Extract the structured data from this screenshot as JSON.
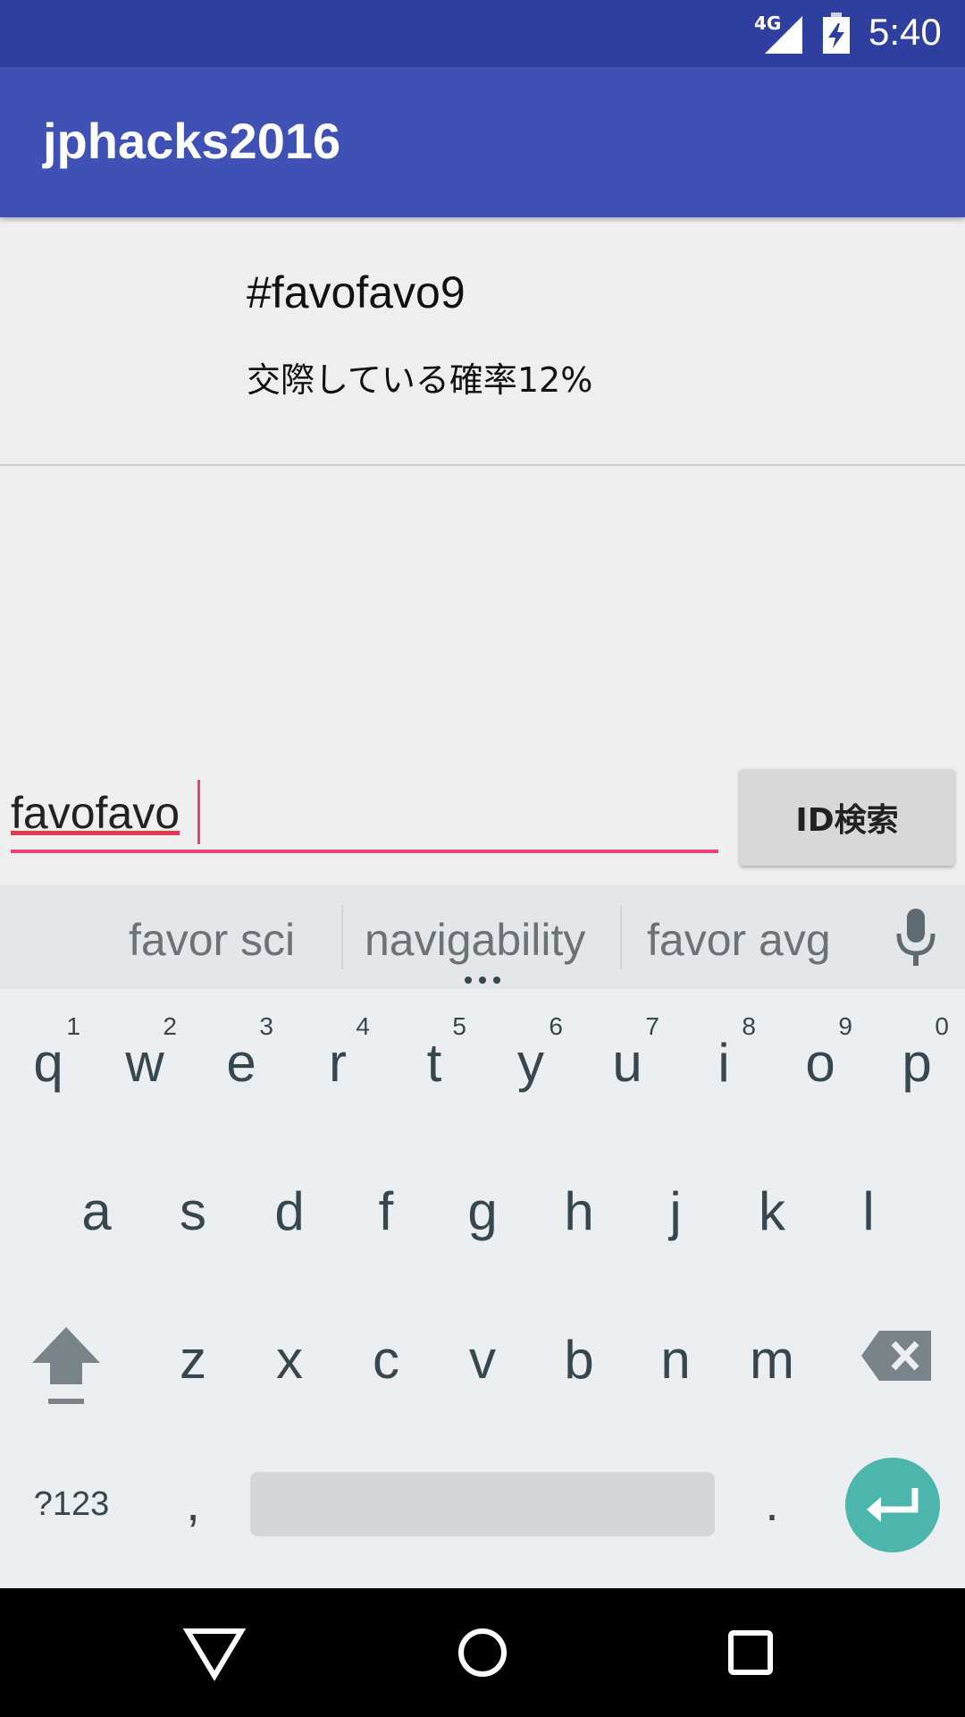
{
  "status_bar": {
    "network": "4G",
    "time": "5:40"
  },
  "app_bar": {
    "title": "jphacks2016"
  },
  "result": {
    "hashtag": "#favofavo9",
    "probability_text": "交際している確率12%"
  },
  "search": {
    "value": "favofavo",
    "button_label": "ID検索"
  },
  "keyboard": {
    "suggestions": [
      "favor sci",
      "navigability",
      "favor avg"
    ],
    "row1": [
      {
        "label": "q",
        "hint": "1"
      },
      {
        "label": "w",
        "hint": "2"
      },
      {
        "label": "e",
        "hint": "3"
      },
      {
        "label": "r",
        "hint": "4"
      },
      {
        "label": "t",
        "hint": "5"
      },
      {
        "label": "y",
        "hint": "6"
      },
      {
        "label": "u",
        "hint": "7"
      },
      {
        "label": "i",
        "hint": "8"
      },
      {
        "label": "o",
        "hint": "9"
      },
      {
        "label": "p",
        "hint": "0"
      }
    ],
    "row2": [
      "a",
      "s",
      "d",
      "f",
      "g",
      "h",
      "j",
      "k",
      "l"
    ],
    "row3": [
      "z",
      "x",
      "c",
      "v",
      "b",
      "n",
      "m"
    ],
    "symbols_label": "?123",
    "comma_label": ",",
    "period_label": ".",
    "icons": {
      "shift": "shift-icon",
      "backspace": "backspace-icon",
      "enter": "enter-icon",
      "mic": "microphone-icon"
    },
    "colors": {
      "enter_bg": "#4db6ac",
      "accent": "#ec407a"
    }
  },
  "nav_bar": {
    "icons": [
      "back-icon",
      "home-icon",
      "recents-icon"
    ]
  },
  "colors": {
    "status_bar": "#2f3f9f",
    "app_bar": "#3f51b5"
  }
}
